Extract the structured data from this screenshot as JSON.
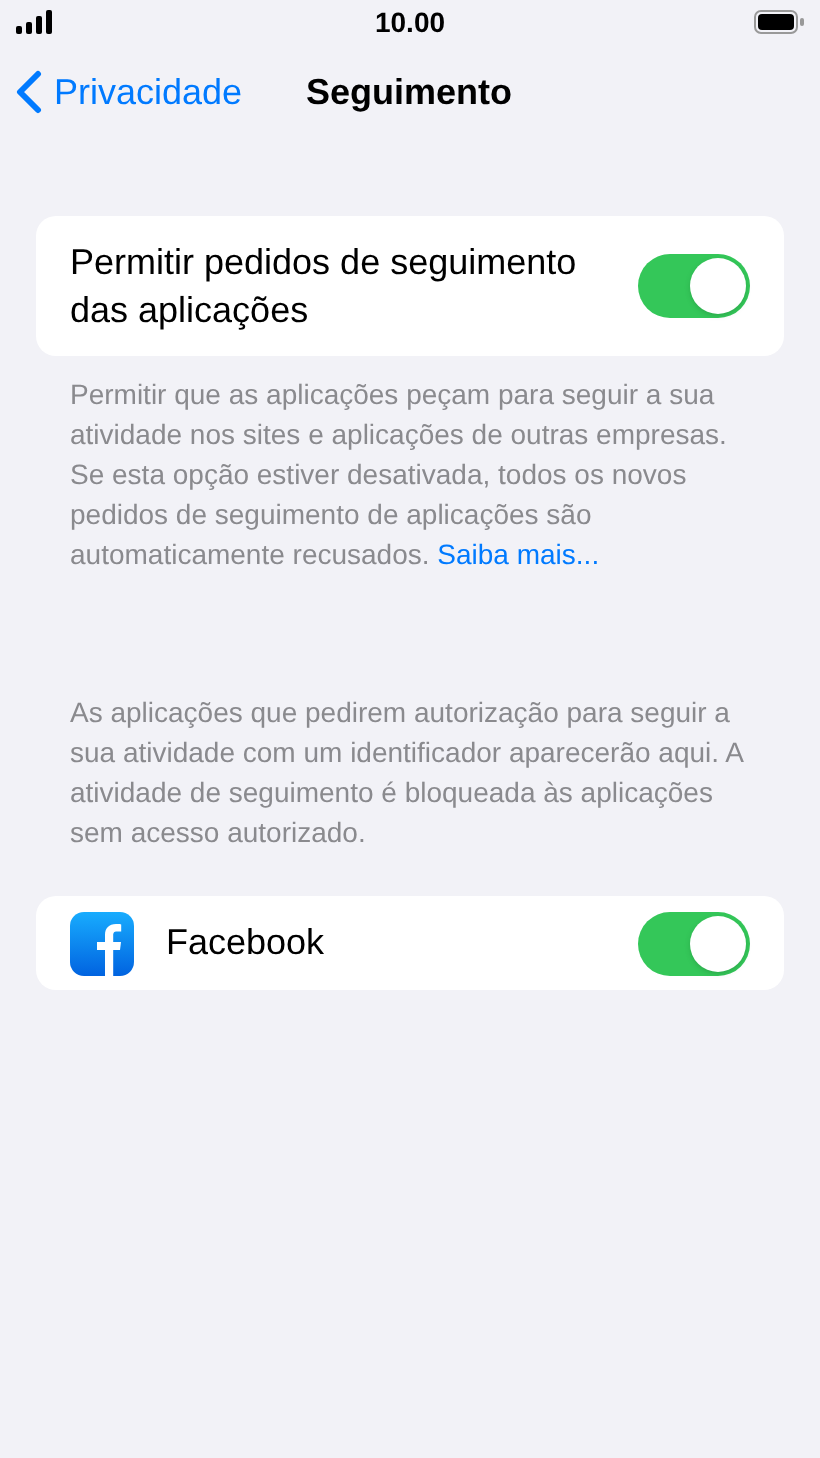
{
  "status_bar": {
    "time": "10.00"
  },
  "nav": {
    "back": "Privacidade",
    "title": "Seguimento"
  },
  "allow_setting": {
    "label": "Permitir pedidos de seguimento das aplicações",
    "on": true
  },
  "allow_footer": {
    "text": "Permitir que as aplicações peçam para seguir a sua atividade nos sites e aplicações de outras empresas. Se esta opção estiver desativada, todos os novos pedidos de seguimento de aplicações são automaticamente recusados.",
    "link": "Saiba mais..."
  },
  "apps_header": "As aplicações que pedirem autorização para seguir a sua atividade com um identificador aparecerão aqui. A atividade de seguimento é bloqueada às aplicações sem acesso autorizado.",
  "apps": [
    {
      "name": "Facebook",
      "on": true
    }
  ]
}
